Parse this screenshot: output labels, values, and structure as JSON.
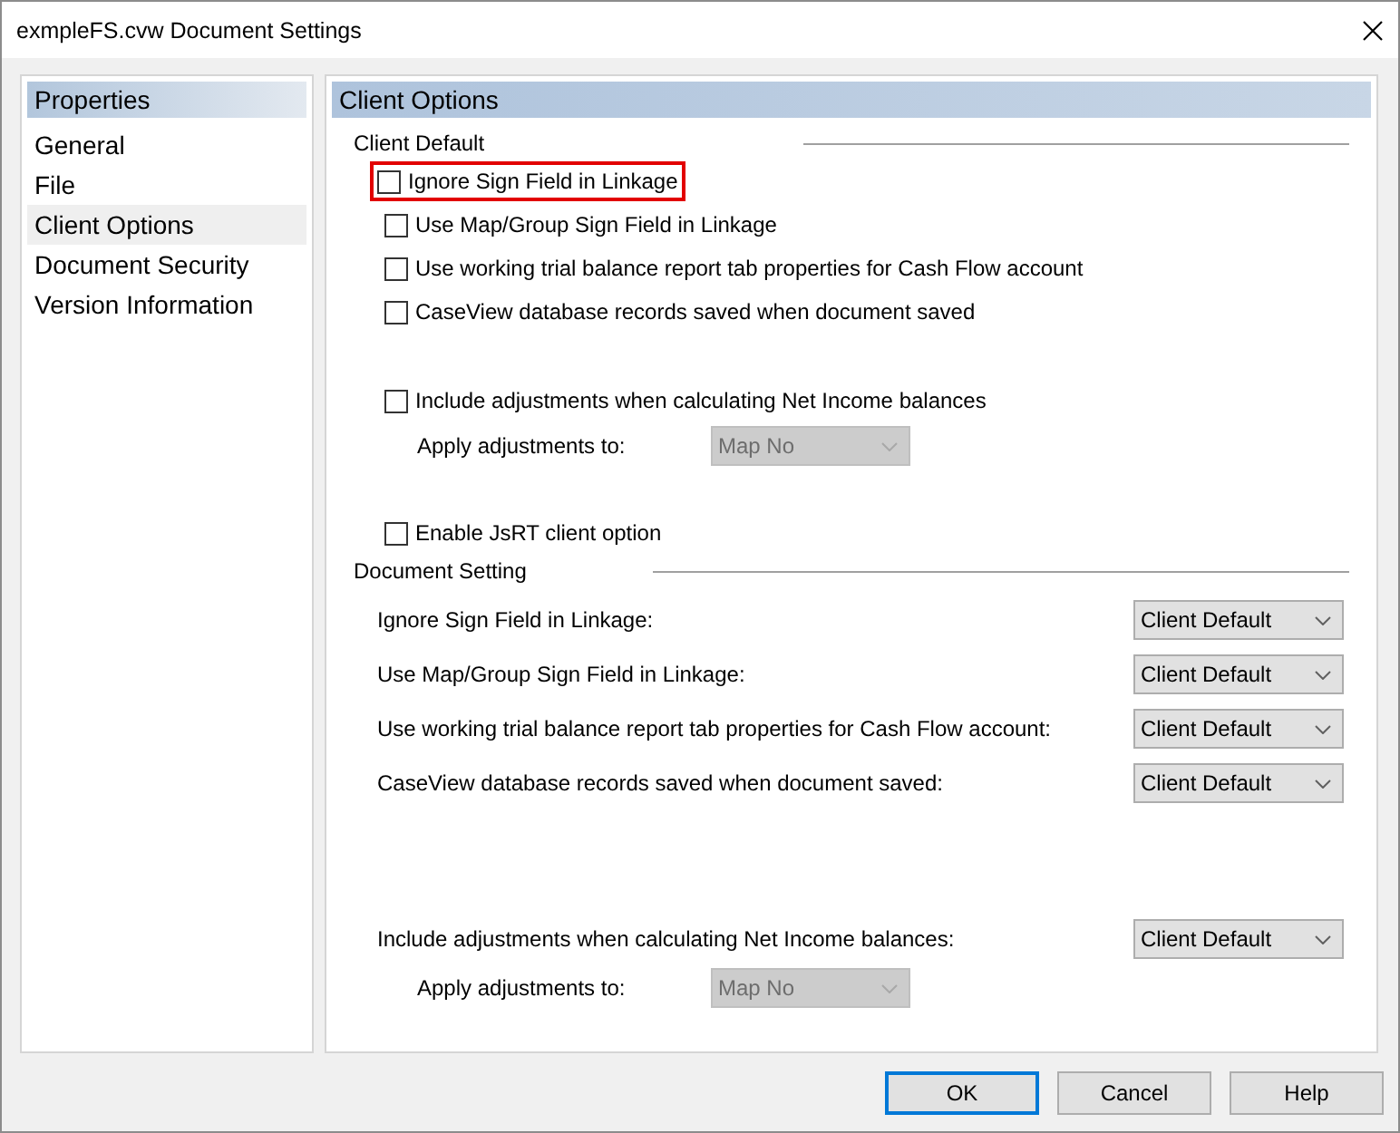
{
  "window": {
    "title": "exmpleFS.cvw Document Settings"
  },
  "sidebar": {
    "header": "Properties",
    "items": [
      {
        "label": "General",
        "selected": false
      },
      {
        "label": "File",
        "selected": false
      },
      {
        "label": "Client Options",
        "selected": true
      },
      {
        "label": "Document Security",
        "selected": false
      },
      {
        "label": "Version Information",
        "selected": false
      }
    ]
  },
  "panel": {
    "header": "Client Options",
    "client_default": {
      "title": "Client Default",
      "options": [
        {
          "label": "Ignore Sign Field in Linkage",
          "checked": false,
          "highlighted": true
        },
        {
          "label": "Use Map/Group Sign Field in Linkage",
          "checked": false,
          "highlighted": false
        },
        {
          "label": "Use working trial balance report tab properties for Cash Flow account",
          "checked": false,
          "highlighted": false
        },
        {
          "label": "CaseView database records saved when document saved",
          "checked": false,
          "highlighted": false
        }
      ],
      "adjustments": {
        "label": "Include adjustments when calculating Net Income balances",
        "checked": false,
        "apply_label": "Apply adjustments to:",
        "apply_value": "Map No",
        "apply_disabled": true
      },
      "jsrt": {
        "label": "Enable JsRT client option",
        "checked": false
      }
    },
    "document_setting": {
      "title": "Document Setting",
      "rows": [
        {
          "label": "Ignore Sign Field in Linkage:",
          "value": "Client Default"
        },
        {
          "label": "Use Map/Group Sign Field in Linkage:",
          "value": "Client Default"
        },
        {
          "label": "Use working trial balance report tab properties for Cash Flow account:",
          "value": "Client Default"
        },
        {
          "label": "CaseView database records saved when document saved:",
          "value": "Client Default"
        }
      ],
      "adjustments": {
        "label": "Include adjustments when calculating Net Income balances:",
        "value": "Client Default",
        "apply_label": "Apply adjustments to:",
        "apply_value": "Map No",
        "apply_disabled": true
      }
    }
  },
  "buttons": [
    {
      "label": "OK",
      "default": true
    },
    {
      "label": "Cancel",
      "default": false
    },
    {
      "label": "Help",
      "default": false
    }
  ]
}
